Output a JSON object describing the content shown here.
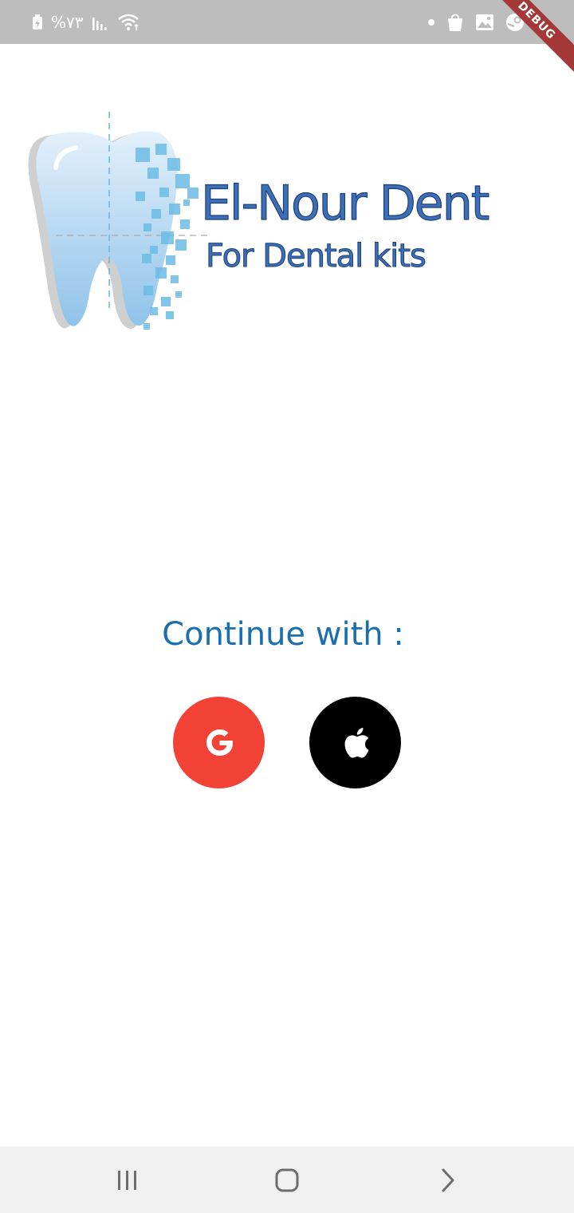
{
  "status_bar": {
    "battery_text": "%٧٣",
    "debug_label": "DEBUG",
    "icons": [
      "battery-charging-icon",
      "signal-icon",
      "wifi-icon",
      "dot-icon",
      "shopping-bag-icon",
      "gallery-icon",
      "steam-icon"
    ]
  },
  "logo": {
    "title": "El-Nour Dent",
    "subtitle": "For Dental kits"
  },
  "main": {
    "continue_label": "Continue with :",
    "google_icon": "google-icon",
    "apple_icon": "apple-icon"
  },
  "colors": {
    "accent": "#1b6fae",
    "google": "#f24236",
    "apple": "#000000",
    "status_bar": "#bdbdbd",
    "nav_bar": "#f0f0f0"
  },
  "nav_bar": {
    "icons": [
      "recent-apps-icon",
      "home-icon",
      "back-icon"
    ]
  }
}
